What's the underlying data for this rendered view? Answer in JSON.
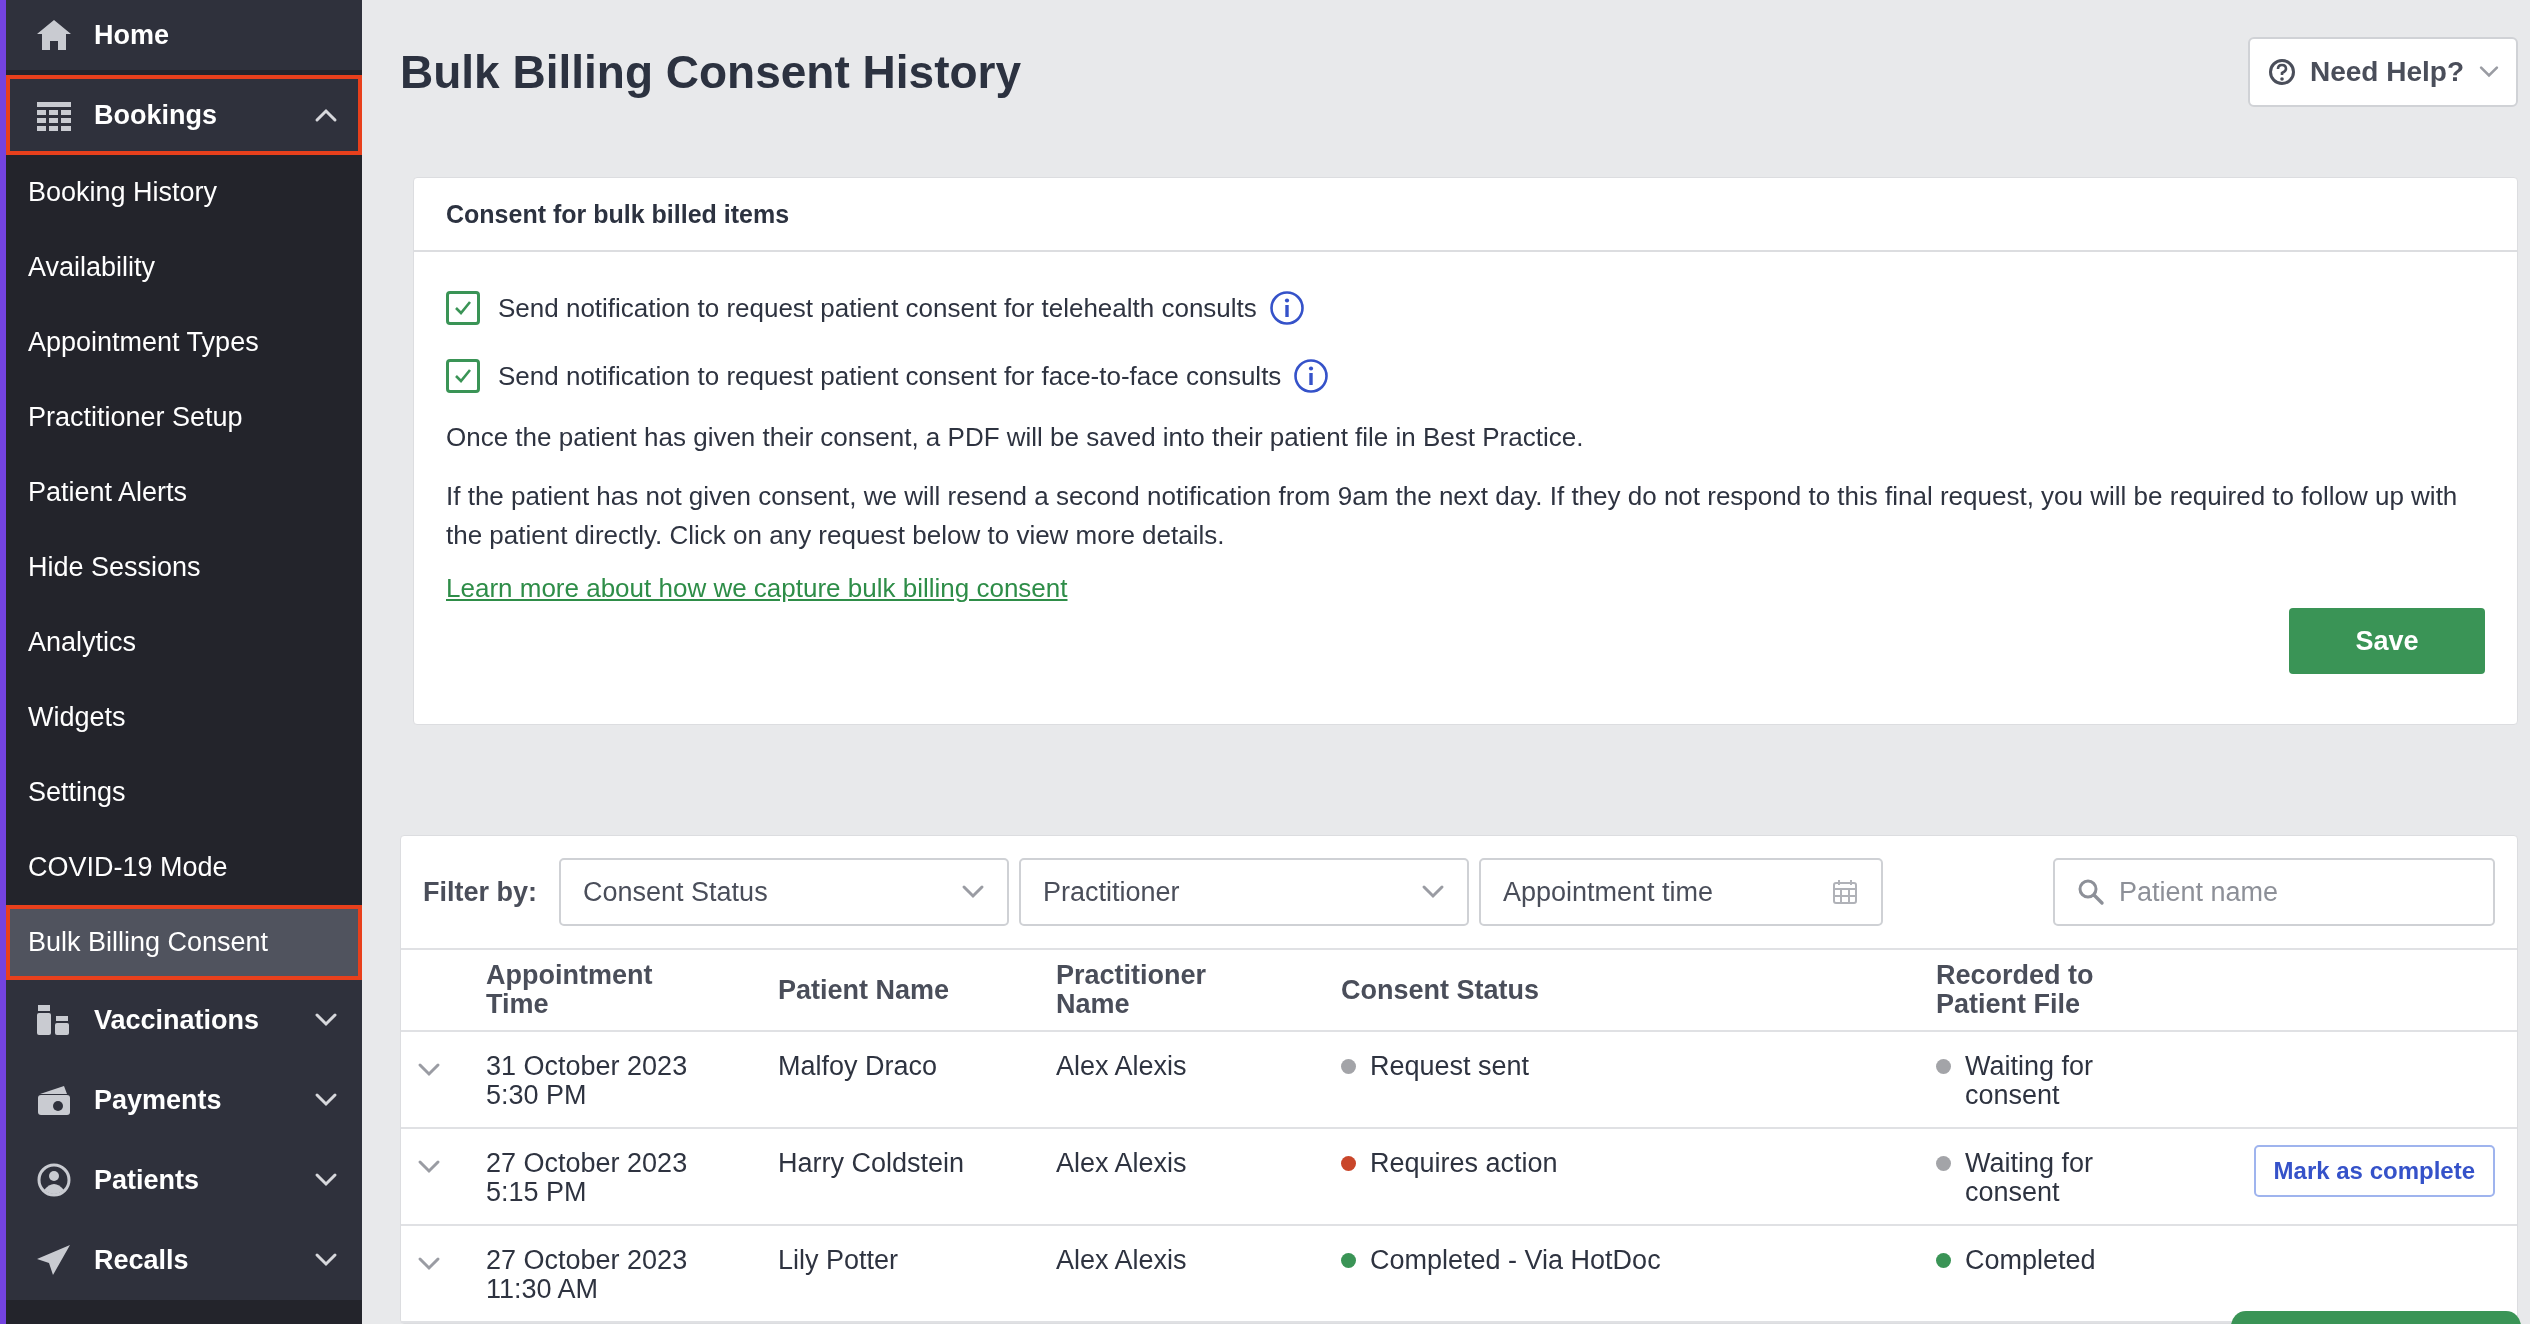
{
  "sidebar": {
    "items": [
      {
        "kind": "link",
        "label": "Home",
        "highlighted": false
      },
      {
        "kind": "group",
        "label": "Bookings",
        "expanded": true,
        "highlighted": true,
        "children": [
          {
            "label": "Booking History",
            "selected": false,
            "highlighted": false
          },
          {
            "label": "Availability",
            "selected": false,
            "highlighted": false
          },
          {
            "label": "Appointment Types",
            "selected": false,
            "highlighted": false
          },
          {
            "label": "Practitioner Setup",
            "selected": false,
            "highlighted": false
          },
          {
            "label": "Patient Alerts",
            "selected": false,
            "highlighted": false
          },
          {
            "label": "Hide Sessions",
            "selected": false,
            "highlighted": false
          },
          {
            "label": "Analytics",
            "selected": false,
            "highlighted": false
          },
          {
            "label": "Widgets",
            "selected": false,
            "highlighted": false
          },
          {
            "label": "Settings",
            "selected": false,
            "highlighted": false
          },
          {
            "label": "COVID-19 Mode",
            "selected": false,
            "highlighted": false
          },
          {
            "label": "Bulk Billing Consent",
            "selected": true,
            "highlighted": true
          }
        ]
      },
      {
        "kind": "group",
        "label": "Vaccinations",
        "expanded": false,
        "highlighted": false
      },
      {
        "kind": "group",
        "label": "Payments",
        "expanded": false,
        "highlighted": false
      },
      {
        "kind": "group",
        "label": "Patients",
        "expanded": false,
        "highlighted": false
      },
      {
        "kind": "group",
        "label": "Recalls",
        "expanded": false,
        "highlighted": false
      }
    ]
  },
  "page": {
    "title": "Bulk Billing Consent History",
    "help_button": "Need Help?"
  },
  "consent_card": {
    "title": "Consent for bulk billed items",
    "options": [
      {
        "label": "Send notification to request patient consent for telehealth consults",
        "checked": true
      },
      {
        "label": "Send notification to request patient consent for face-to-face consults",
        "checked": true
      }
    ],
    "paragraphs": [
      "Once the patient has given their consent, a PDF will be saved into their patient file in Best Practice.",
      "If the patient has not given consent, we will resend a second notification from 9am the next day. If they do not respond to this final request, you will be required to follow up with the patient directly. Click on any request below to view more details."
    ],
    "link": "Learn more about how we capture bulk billing consent",
    "save_button": "Save"
  },
  "filters": {
    "label": "Filter by:",
    "fields": [
      {
        "kind": "select",
        "placeholder": "Consent Status"
      },
      {
        "kind": "select",
        "placeholder": "Practitioner"
      },
      {
        "kind": "date",
        "placeholder": "Appointment time"
      },
      {
        "kind": "search",
        "placeholder": "Patient name"
      }
    ]
  },
  "table": {
    "columns": [
      "Appointment Time",
      "Patient Name",
      "Practitioner Name",
      "Consent Status",
      "Recorded to Patient File"
    ],
    "rows": [
      {
        "date": "31 October 2023",
        "time": "5:30 PM",
        "patient": "Malfoy Draco",
        "practitioner": "Alex Alexis",
        "consent_status": {
          "label": "Request sent",
          "color": "#a3a4a8"
        },
        "recorded": {
          "label": "Waiting for consent",
          "color": "#a3a4a8"
        }
      },
      {
        "date": "27 October 2023",
        "time": "5:15 PM",
        "patient": "Harry Coldstein",
        "practitioner": "Alex Alexis",
        "consent_status": {
          "label": "Requires action",
          "color": "#c9462a"
        },
        "recorded": {
          "label": "Waiting for consent",
          "color": "#a3a4a8"
        },
        "action": "Mark as complete"
      },
      {
        "date": "27 October 2023",
        "time": "11:30 AM",
        "patient": "Lily Potter",
        "practitioner": "Alex Alexis",
        "consent_status": {
          "label": "Completed - Via HotDoc",
          "color": "#3a9456"
        },
        "recorded": {
          "label": "Completed",
          "color": "#3a9456"
        }
      }
    ]
  }
}
